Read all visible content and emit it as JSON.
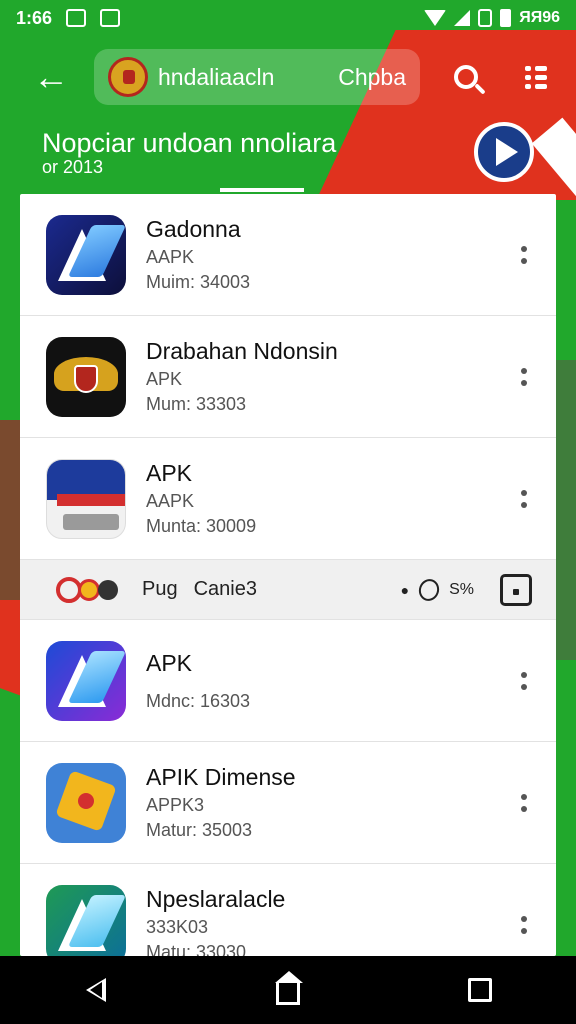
{
  "status_bar": {
    "time": "1:66",
    "right_text": "ЯЯ96"
  },
  "app_bar": {
    "search_query": "hndaliaacln",
    "search_chip": "Chpba"
  },
  "section": {
    "title": "Nopciar undoan nnoliara",
    "subtitle": "or 2013"
  },
  "apps": [
    {
      "name": "Gadonna",
      "type": "AAPK",
      "meta": "Muim: 34003",
      "icon": "a-logo-icon"
    },
    {
      "name": "Drabahan Ndonsin",
      "type": "APK",
      "meta": "Mum: 33303",
      "icon": "garuda-emblem-icon"
    },
    {
      "name": "APK",
      "type": "AAPK",
      "meta": "Munta: 30009",
      "icon": "flag-box-icon"
    }
  ],
  "promo": {
    "label1": "Pug",
    "label2": "Canie3",
    "percent": "S%"
  },
  "apps2": [
    {
      "name": "APK",
      "meta": "Mdnc: 16303",
      "icon": "a-logo-gradient-icon"
    },
    {
      "name": "APIK Dimense",
      "type": "APPK3",
      "meta": "Matur: 35003",
      "icon": "star-badge-icon"
    },
    {
      "name": "Npeslaralacle",
      "type": "333K03",
      "meta": "Matu: 33030",
      "icon": "a-logo-green-icon"
    }
  ],
  "colors": {
    "primary_green": "#21a82c",
    "accent_red": "#e0321e",
    "fab_blue": "#1a3d8a"
  }
}
